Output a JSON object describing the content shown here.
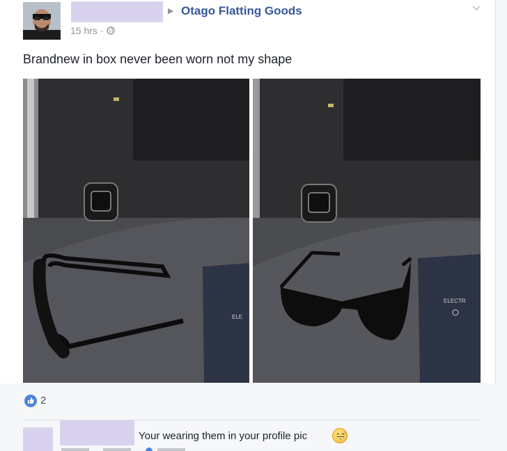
{
  "post": {
    "page_name": "Otago Flatting Goods",
    "timestamp": "15 hrs",
    "privacy_icon": "globe-icon",
    "text": "Brandnew in box never been worn not my shape",
    "options_icon": "chevron-down-icon"
  },
  "reactions": {
    "icon": "like-icon",
    "count": "2"
  },
  "comment": {
    "text": "Your wearing them in your profile pic",
    "emoji": "grinning-sweat-emoji"
  },
  "colors": {
    "link": "#365899",
    "like": "#4c85dc",
    "redaction": "#d9d2ef"
  }
}
